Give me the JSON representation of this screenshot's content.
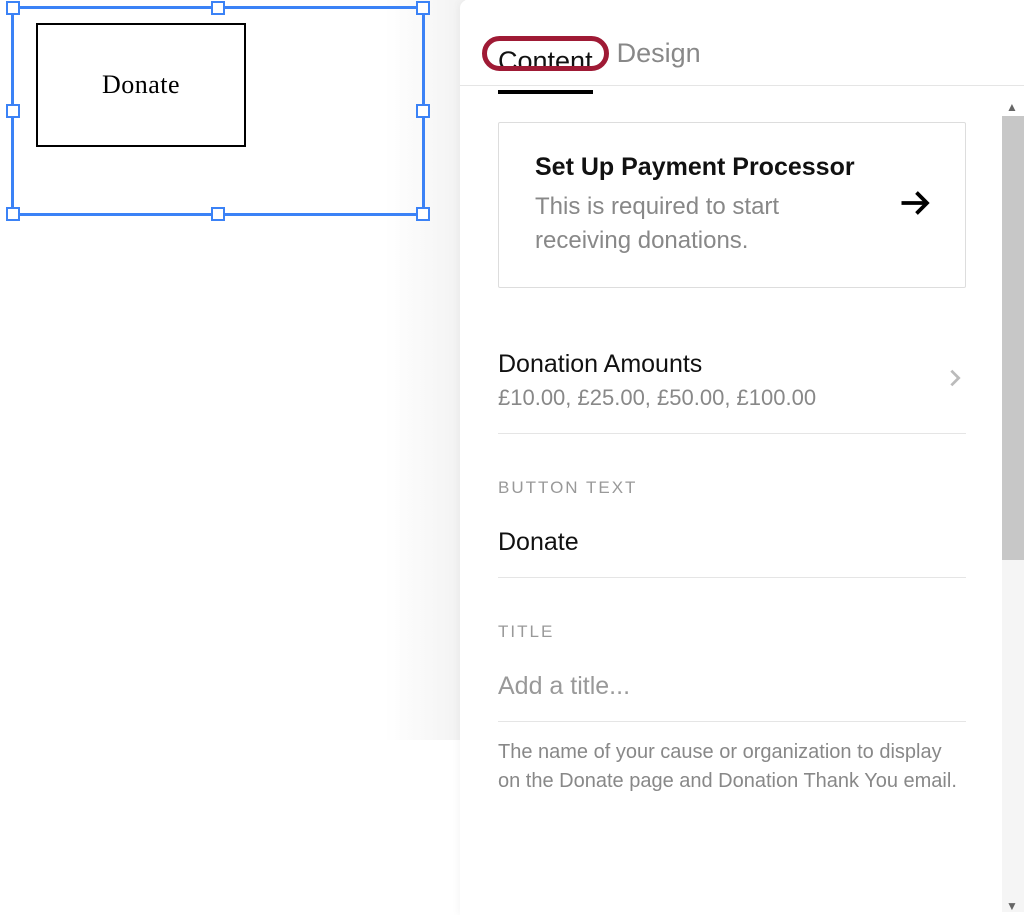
{
  "canvas": {
    "button_preview_text": "Donate"
  },
  "panel": {
    "tabs": {
      "content": "Content",
      "design": "Design"
    },
    "setup_card": {
      "title": "Set Up Payment Processor",
      "description": "This is required to start receiving donations."
    },
    "donation_amounts": {
      "label": "Donation Amounts",
      "values": "£10.00, £25.00, £50.00, £100.00"
    },
    "button_text": {
      "label": "BUTTON TEXT",
      "value": "Donate"
    },
    "title_field": {
      "label": "TITLE",
      "placeholder": "Add a title...",
      "help": "The name of your cause or organization to display on the Donate page and Donation Thank You email."
    }
  }
}
